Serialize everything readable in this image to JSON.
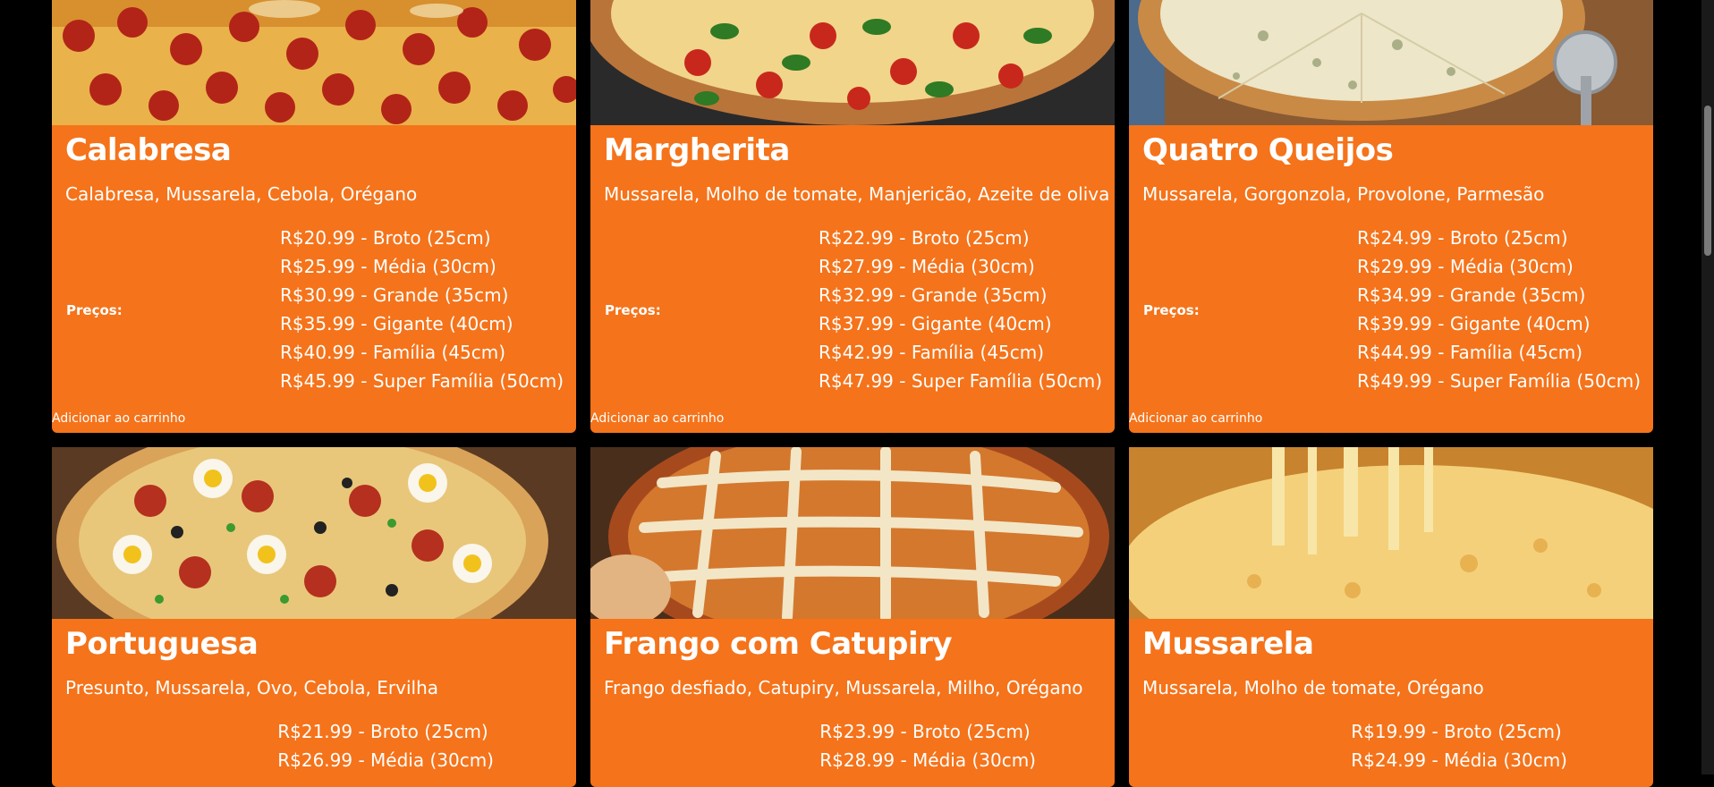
{
  "pizzas": [
    {
      "name": "Calabresa",
      "ingredients": "Calabresa, Mussarela, Cebola, Orégano",
      "prices_label": "Preços:",
      "prices": [
        "R$20.99 - Broto (25cm)",
        "R$25.99 - Média (30cm)",
        "R$30.99 - Grande (35cm)",
        "R$35.99 - Gigante (40cm)",
        "R$40.99 - Família (45cm)",
        "R$45.99 - Super Família (50cm)"
      ],
      "add_label": "Adicionar ao carrinho"
    },
    {
      "name": "Margherita",
      "ingredients": "Mussarela, Molho de tomate, Manjericão, Azeite de oliva",
      "prices_label": "Preços:",
      "prices": [
        "R$22.99 - Broto (25cm)",
        "R$27.99 - Média (30cm)",
        "R$32.99 - Grande (35cm)",
        "R$37.99 - Gigante (40cm)",
        "R$42.99 - Família (45cm)",
        "R$47.99 - Super Família (50cm)"
      ],
      "add_label": "Adicionar ao carrinho"
    },
    {
      "name": "Quatro Queijos",
      "ingredients": "Mussarela, Gorgonzola, Provolone, Parmesão",
      "prices_label": "Preços:",
      "prices": [
        "R$24.99 - Broto (25cm)",
        "R$29.99 - Média (30cm)",
        "R$34.99 - Grande (35cm)",
        "R$39.99 - Gigante (40cm)",
        "R$44.99 - Família (45cm)",
        "R$49.99 - Super Família (50cm)"
      ],
      "add_label": "Adicionar ao carrinho"
    },
    {
      "name": "Portuguesa",
      "ingredients": "Presunto, Mussarela, Ovo, Cebola, Ervilha",
      "prices": [
        "R$21.99 - Broto (25cm)",
        "R$26.99 - Média (30cm)"
      ]
    },
    {
      "name": "Frango com Catupiry",
      "ingredients": "Frango desfiado, Catupiry, Mussarela, Milho, Orégano",
      "prices": [
        "R$23.99 - Broto (25cm)",
        "R$28.99 - Média (30cm)"
      ]
    },
    {
      "name": "Mussarela",
      "ingredients": "Mussarela, Molho de tomate, Orégano",
      "prices": [
        "R$19.99 - Broto (25cm)",
        "R$24.99 - Média (30cm)"
      ]
    }
  ],
  "colors": {
    "card": "#F5731A",
    "background": "#000000",
    "text": "#FFFFFF"
  }
}
